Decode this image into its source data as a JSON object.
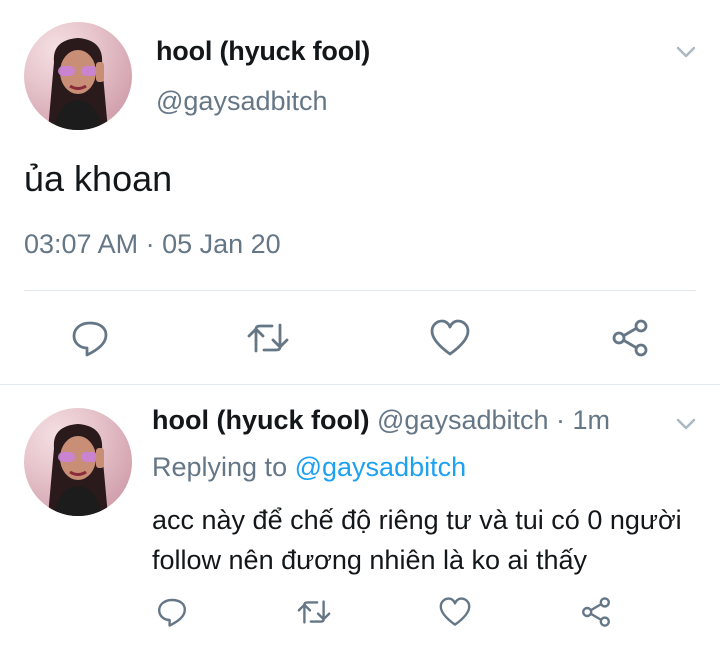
{
  "main_tweet": {
    "display_name": "hool (hyuck fool)",
    "handle": "@gaysadbitch",
    "text": "ủa khoan",
    "timestamp": "03:07 AM · 05 Jan 20"
  },
  "reply_tweet": {
    "display_name": "hool (hyuck fool)",
    "handle": "@gaysadbitch",
    "time_ago": "· 1m",
    "replying_label": "Replying to",
    "replying_handle": "@gaysadbitch",
    "text": "acc này để chế độ riêng tư và tui có 0 người follow nên đương nhiên là ko ai thấy"
  },
  "icons": {
    "reply": "reply-icon",
    "retweet": "retweet-icon",
    "like": "heart-icon",
    "share": "share-icon",
    "menu": "chevron-down-icon"
  },
  "colors": {
    "text": "#14171a",
    "secondary": "#657786",
    "link": "#1da1f2",
    "divider": "#e1e8ed"
  }
}
